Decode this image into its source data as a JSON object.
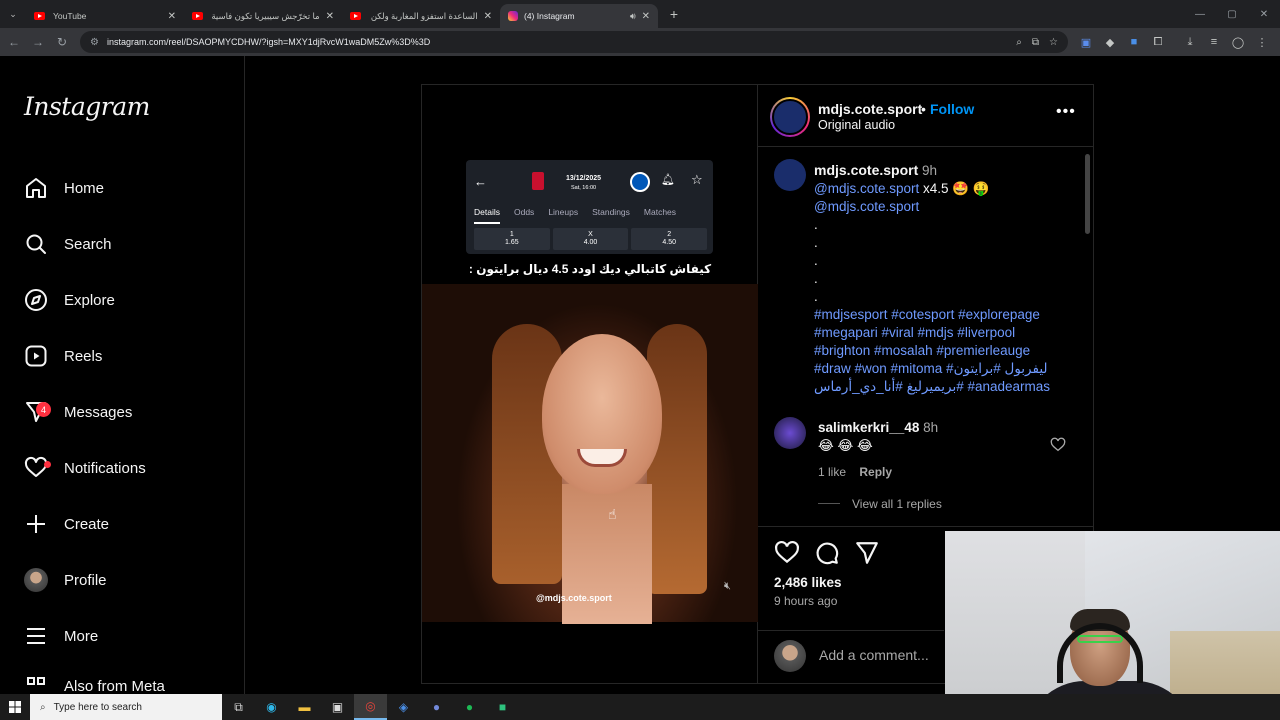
{
  "browser": {
    "tabs": [
      {
        "title": "YouTube",
        "icon": "youtube-icon",
        "active": false
      },
      {
        "title": "ما تخرّجش سيبيريا تكون فاسية ق",
        "icon": "youtube-icon",
        "active": false
      },
      {
        "title": "الساعدة استفزو المغاربة ولكن ال",
        "icon": "youtube-icon",
        "active": false
      },
      {
        "title": "(4) Instagram",
        "icon": "instagram-icon",
        "active": true
      }
    ],
    "url": "instagram.com/reel/DSAOPMYCDHW/?igsh=MXY1djRvcW1waDM5Zw%3D%3D"
  },
  "sidebar": {
    "logo": "Instagram",
    "items": [
      {
        "label": "Home",
        "icon": "home-icon"
      },
      {
        "label": "Search",
        "icon": "search-icon"
      },
      {
        "label": "Explore",
        "icon": "compass-icon"
      },
      {
        "label": "Reels",
        "icon": "reels-icon"
      },
      {
        "label": "Messages",
        "icon": "messenger-icon",
        "badge": "4"
      },
      {
        "label": "Notifications",
        "icon": "heart-icon"
      },
      {
        "label": "Create",
        "icon": "plus-icon"
      },
      {
        "label": "Profile",
        "icon": "avatar"
      },
      {
        "label": "More",
        "icon": "hamburger-icon"
      },
      {
        "label": "Also from Meta",
        "icon": "meta-icon"
      }
    ]
  },
  "video": {
    "card_date": "13/12/2025",
    "card_time": "Sat, 16:00",
    "card_tabs": [
      "Details",
      "Odds",
      "Lineups",
      "Standings",
      "Matches"
    ],
    "odds": [
      {
        "k": "1",
        "v": "1.65"
      },
      {
        "k": "X",
        "v": "4.00"
      },
      {
        "k": "2",
        "v": "4.50"
      }
    ],
    "caption": "كيفاش كاتبالي ديك اودد 4.5 ديال برايتون :",
    "watermark": "@mdjs.cote.sport"
  },
  "post": {
    "username": "mdjs.cote.sport",
    "follow": "Follow",
    "audio": "Original audio",
    "caption_user": "mdjs.cote.sport",
    "caption_time": "9h",
    "line1_mention": "@mdjs.cote.sport",
    "line1_rest": " x4.5 🤩 🤑",
    "line2_mention": "@mdjs.cote.sport",
    "dots": [
      ".",
      ".",
      ".",
      ".",
      "."
    ],
    "hashtags": "#mdjsesport #cotesport #explorepage #megapari #viral #mdjs #liverpool #brighton #mosalah #premierleauge #draw #won #mitoma #ليفربول #برايتون #بريميرليغ #أنا_دي_أرماس #anadearmas",
    "comment_user": "salimkerkri__48",
    "comment_time": "8h",
    "comment_text": "😂 😂 😂",
    "comment_likes": "1 like",
    "reply": "Reply",
    "view_replies": "View all 1 replies",
    "likes": "2,486 likes",
    "time_ago": "9 hours ago",
    "add_comment": "Add a comment..."
  },
  "taskbar": {
    "search_placeholder": "Type here to search"
  }
}
